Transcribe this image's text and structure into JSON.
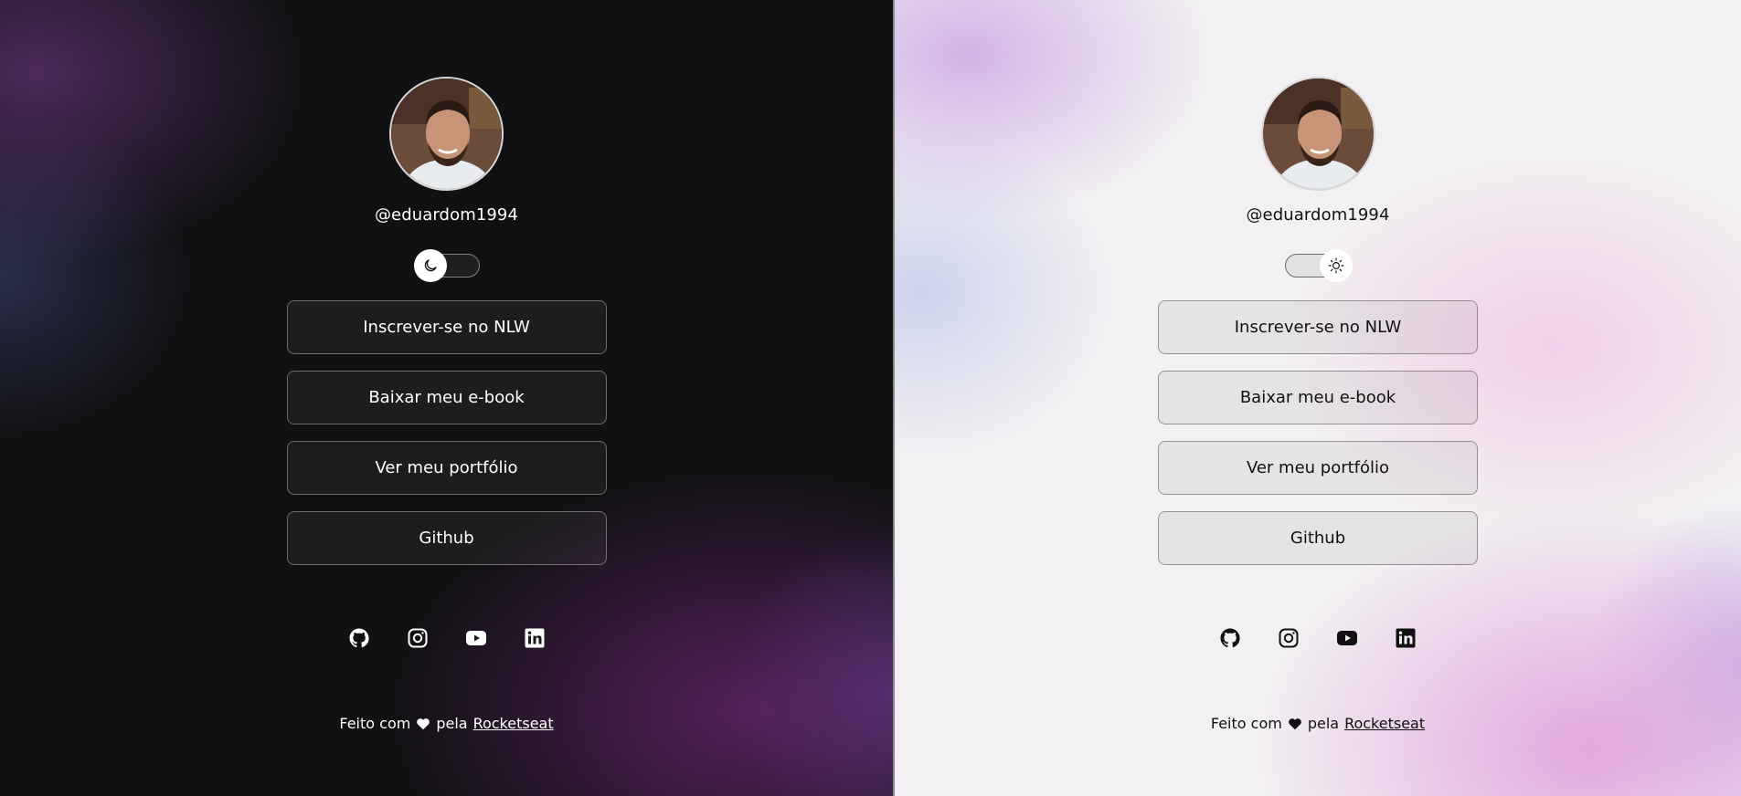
{
  "panels": {
    "dark": {
      "theme": "dark",
      "username": "@eduardom1994",
      "toggle_icon": "moon-icon",
      "buttons": [
        "Inscrever-se no NLW",
        "Baixar meu e-book",
        "Ver meu portfólio",
        "Github"
      ],
      "socials": [
        "github-icon",
        "instagram-icon",
        "youtube-icon",
        "linkedin-icon"
      ],
      "footer": {
        "prefix": "Feito com",
        "icon": "heart-icon",
        "middle": "pela",
        "link": "Rocketseat"
      }
    },
    "light": {
      "theme": "light",
      "username": "@eduardom1994",
      "toggle_icon": "sun-icon",
      "buttons": [
        "Inscrever-se no NLW",
        "Baixar meu e-book",
        "Ver meu portfólio",
        "Github"
      ],
      "socials": [
        "github-icon",
        "instagram-icon",
        "youtube-icon",
        "linkedin-icon"
      ],
      "footer": {
        "prefix": "Feito com",
        "icon": "heart-icon",
        "middle": "pela",
        "link": "Rocketseat"
      }
    }
  },
  "colors": {
    "dark_bg": "#111113",
    "dark_accent_purple": "#6b2a78",
    "light_bg": "#f2f0f2",
    "light_accent_pink": "#e2a8dc"
  }
}
